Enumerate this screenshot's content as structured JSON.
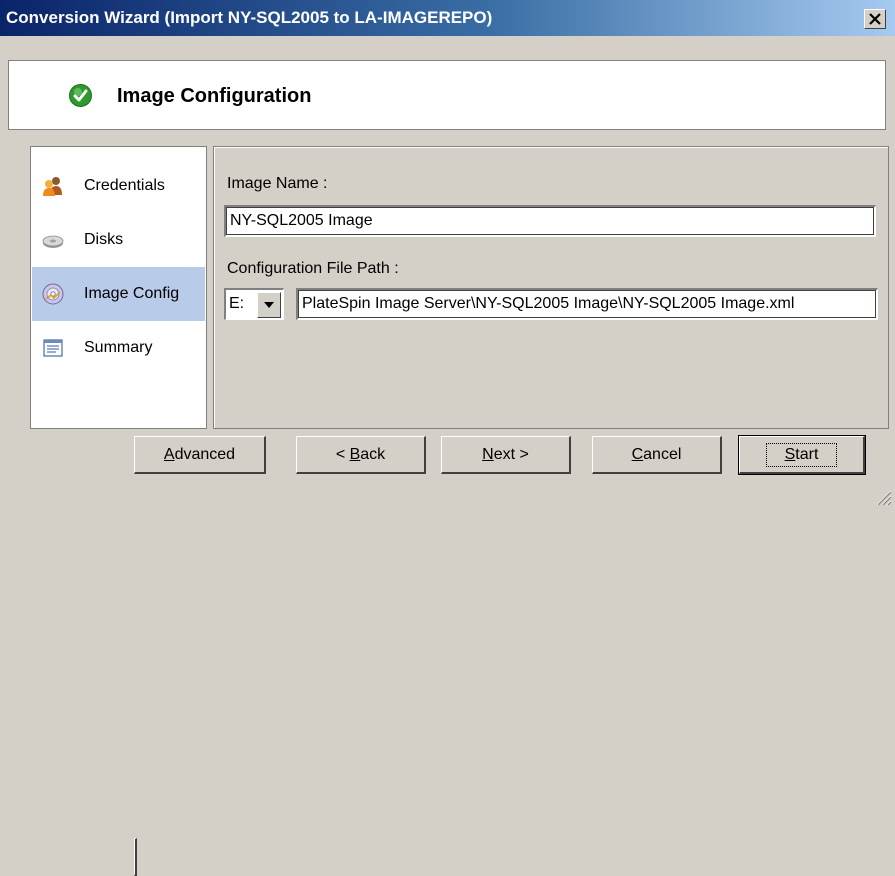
{
  "window": {
    "title": "Conversion Wizard (Import NY-SQL2005 to LA-IMAGEREPO)",
    "close_glyph": "✕",
    "titlebar_colors": [
      "#0a246a",
      "#a6caf0"
    ]
  },
  "header": {
    "title": "Image Configuration",
    "icon": "check-circle-icon",
    "icon_color": "#2e9a2e"
  },
  "sidebar": {
    "items": [
      {
        "label": "Credentials",
        "icon": "users-icon",
        "selected": false
      },
      {
        "label": "Disks",
        "icon": "disk-icon",
        "selected": false
      },
      {
        "label": "Image Config",
        "icon": "image-config-icon",
        "selected": true
      },
      {
        "label": "Summary",
        "icon": "summary-icon",
        "selected": false
      }
    ],
    "selected_color": "#b8cbe8"
  },
  "form": {
    "image_name_label": "Image Name :",
    "image_name_value": "NY-SQL2005 Image",
    "config_path_label": "Configuration File Path :",
    "drive_value": "E:",
    "config_path_value": "PlateSpin Image Server\\NY-SQL2005 Image\\NY-SQL2005 Image.xml"
  },
  "buttons": {
    "advanced": {
      "pre": "",
      "key": "A",
      "post": "dvanced"
    },
    "back": {
      "pre": "< ",
      "key": "B",
      "post": "ack"
    },
    "next": {
      "pre": "",
      "key": "N",
      "post": "ext >"
    },
    "cancel": {
      "pre": "",
      "key": "C",
      "post": "ancel"
    },
    "start": {
      "pre": "",
      "key": "S",
      "post": "tart"
    }
  }
}
